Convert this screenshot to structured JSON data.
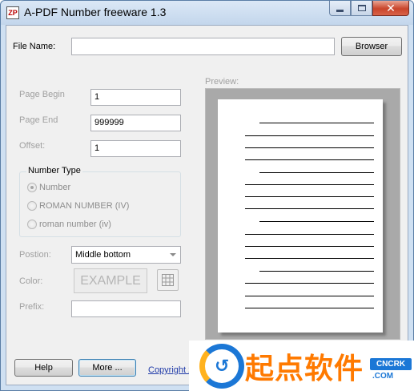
{
  "window": {
    "title": "A-PDF Number freeware 1.3",
    "app_icon_text": "ZP",
    "caption_buttons": [
      "minimize-icon",
      "maximize-icon",
      "close-icon"
    ]
  },
  "file": {
    "label": "File Name:",
    "value": "",
    "browse_label": "Browser"
  },
  "range": {
    "page_begin_label": "Page Begin",
    "page_begin_value": "1",
    "page_end_label": "Page End",
    "page_end_value": "999999",
    "offset_label": "Offset:",
    "offset_value": "1"
  },
  "number_type": {
    "title": "Number Type",
    "options": [
      {
        "label": "Number",
        "checked": true
      },
      {
        "label": "ROMAN NUMBER (IV)",
        "checked": false
      },
      {
        "label": "roman number (iv)",
        "checked": false
      }
    ]
  },
  "format": {
    "position_label": "Postion:",
    "position_value": "Middle bottom",
    "color_label": "Color:",
    "color_example": "EXAMPLE",
    "prefix_label": "Prefix:",
    "prefix_value": ""
  },
  "preview": {
    "label": "Preview:"
  },
  "footer": {
    "help_label": "Help",
    "more_label": "More ...",
    "copyright_text": "Copyright 2"
  },
  "watermark": {
    "text": "起点软件",
    "badge": "CNCRK",
    "sub": ".COM"
  },
  "colors": {
    "disabled_text": "#a0a0a0",
    "link": "#1f3aa8",
    "watermark_orange": "#ff7a00",
    "watermark_blue": "#1b77d6"
  }
}
